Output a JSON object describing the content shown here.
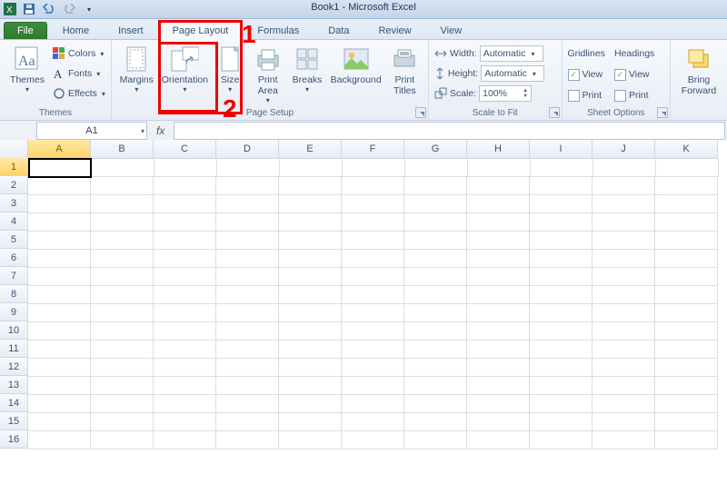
{
  "titlebar": {
    "title": "Book1 - Microsoft Excel"
  },
  "tabs": {
    "file": "File",
    "list": [
      "Home",
      "Insert",
      "Page Layout",
      "Formulas",
      "Data",
      "Review",
      "View"
    ],
    "activeIndex": 2
  },
  "ribbon": {
    "themes": {
      "label": "Themes",
      "btn": "Themes",
      "colors": "Colors",
      "fonts": "Fonts",
      "effects": "Effects"
    },
    "pagesetup": {
      "label": "Page Setup",
      "margins": "Margins",
      "orientation": "Orientation",
      "size": "Size",
      "printarea": "Print\nArea",
      "breaks": "Breaks",
      "background": "Background",
      "printtitles": "Print\nTitles"
    },
    "scale": {
      "label": "Scale to Fit",
      "widthLbl": "Width:",
      "heightLbl": "Height:",
      "scaleLbl": "Scale:",
      "widthVal": "Automatic",
      "heightVal": "Automatic",
      "scaleVal": "100%"
    },
    "sheet": {
      "label": "Sheet Options",
      "gridlines": "Gridlines",
      "headings": "Headings",
      "view": "View",
      "print": "Print"
    },
    "arrange": {
      "bring": "Bring\nForward"
    }
  },
  "formulaBar": {
    "cellRef": "A1",
    "fx": "fx"
  },
  "columns": [
    "A",
    "B",
    "C",
    "D",
    "E",
    "F",
    "G",
    "H",
    "I",
    "J",
    "K"
  ],
  "rowCount": 16,
  "annotations": {
    "one": "1",
    "two": "2"
  }
}
